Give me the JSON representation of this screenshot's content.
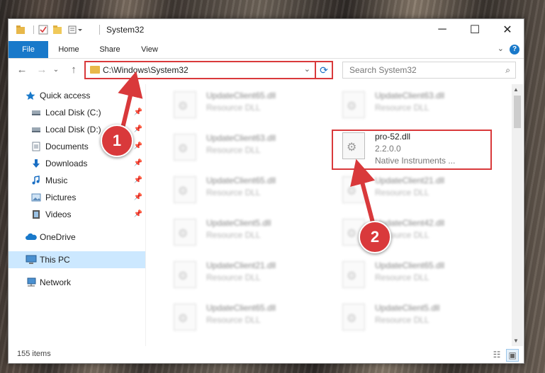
{
  "window": {
    "title": "System32",
    "controls": {
      "minimize": "─",
      "maximize": "☐",
      "close": "✕"
    }
  },
  "ribbon": {
    "tabs": [
      {
        "label": "File"
      },
      {
        "label": "Home"
      },
      {
        "label": "Share"
      },
      {
        "label": "View"
      }
    ],
    "help_label": "?"
  },
  "navigation": {
    "back": "←",
    "forward": "→",
    "up": "↑",
    "address": "C:\\Windows\\System32",
    "search_placeholder": "Search System32"
  },
  "sidebar": {
    "items": [
      {
        "label": "Quick access",
        "icon": "star-icon"
      },
      {
        "label": "Local Disk (C:)",
        "icon": "drive-icon",
        "pinned": true
      },
      {
        "label": "Local Disk (D:)",
        "icon": "drive-icon",
        "pinned": true
      },
      {
        "label": "Documents",
        "icon": "documents-icon",
        "pinned": true
      },
      {
        "label": "Downloads",
        "icon": "download-icon",
        "pinned": true
      },
      {
        "label": "Music",
        "icon": "music-icon",
        "pinned": true
      },
      {
        "label": "Pictures",
        "icon": "pictures-icon",
        "pinned": true
      },
      {
        "label": "Videos",
        "icon": "videos-icon",
        "pinned": true
      },
      {
        "label": "OneDrive",
        "icon": "cloud-icon"
      },
      {
        "label": "This PC",
        "icon": "computer-icon",
        "selected": true
      },
      {
        "label": "Network",
        "icon": "network-icon"
      }
    ]
  },
  "files": {
    "left_column": [
      {
        "name": "UpdateClient65.dll",
        "type": "Resource DLL"
      },
      {
        "name": "UpdateClient63.dll",
        "type": "Resource DLL"
      },
      {
        "name": "UpdateClient65.dll",
        "type": "Resource DLL"
      },
      {
        "name": "UpdateClient5.dll",
        "type": "Resource DLL"
      },
      {
        "name": "UpdateClient21.dll",
        "type": "Resource DLL"
      },
      {
        "name": "UpdateClient65.dll",
        "type": "Resource DLL"
      }
    ],
    "right_column": [
      {
        "name": "UpdateClient63.dll",
        "type": "Resource DLL"
      },
      {
        "name": "pro-52.dll",
        "version": "2.2.0.0",
        "company": "Native Instruments ...",
        "highlighted": true
      },
      {
        "name": "UpdateClient21.dll",
        "type": "Resource DLL"
      },
      {
        "name": "UpdateClient42.dll",
        "type": "Resource DLL"
      },
      {
        "name": "UpdateClient65.dll",
        "type": "Resource DLL"
      },
      {
        "name": "UpdateClient5.dll",
        "type": "Resource DLL"
      }
    ]
  },
  "status": {
    "item_count": "155 items"
  },
  "callouts": [
    {
      "label": "1"
    },
    {
      "label": "2"
    }
  ],
  "colors": {
    "accent": "#1979ca",
    "callout_red": "#d9393b",
    "selected_bg": "#cce8ff"
  }
}
